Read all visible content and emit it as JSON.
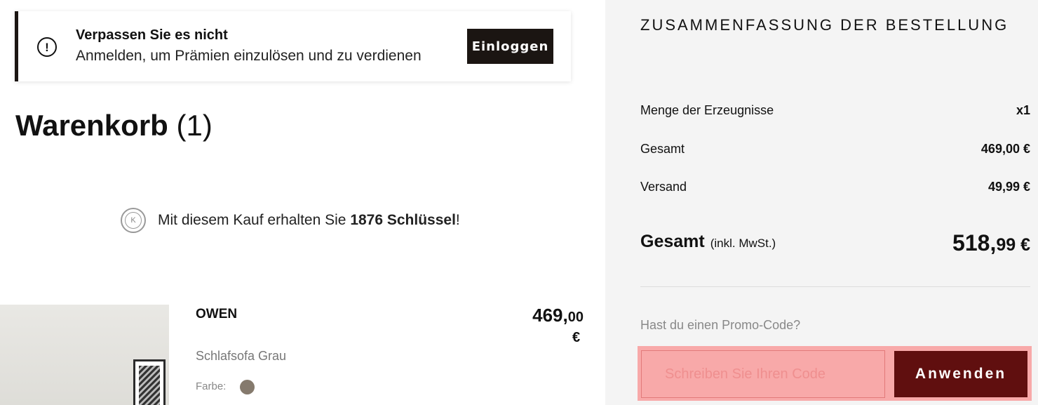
{
  "banner": {
    "title": "Verpassen Sie es nicht",
    "text": "Anmelden, um Prämien einzulösen und zu verdienen",
    "login_label": "Einloggen"
  },
  "cart": {
    "title": "Warenkorb",
    "count": "(1)",
    "keys_prefix": "Mit diesem Kauf erhalten Sie",
    "keys_value": "1876 Schlüssel",
    "keys_suffix": " !",
    "keys_icon_letter": "K"
  },
  "product": {
    "name": "OWEN",
    "price_int": "469,",
    "price_dec": "00",
    "currency": "€",
    "description": "Schlafsofa Grau",
    "color_label": "Farbe:",
    "color_hex": "#857a6d"
  },
  "summary": {
    "title": "ZUSAMMENFASSUNG DER BESTELLUNG",
    "rows": [
      {
        "label": "Menge der Erzeugnisse",
        "value": "x1"
      },
      {
        "label": "Gesamt",
        "value": "469,00 €"
      },
      {
        "label": "Versand",
        "value": "49,99 €"
      }
    ],
    "total_label": "Gesamt",
    "total_sub": "(inkl. MwSt.)",
    "total_int": "518,",
    "total_dec": "99 €",
    "promo_label": "Hast du einen Promo-Code?",
    "promo_placeholder": "Schreiben Sie Ihren Code",
    "apply_label": "Anwenden"
  },
  "colors": {
    "dark": "#1b1512",
    "apply_bg": "#600f0f",
    "promo_highlight": "#f8a9a9",
    "panel_bg": "#f4f4f4"
  }
}
